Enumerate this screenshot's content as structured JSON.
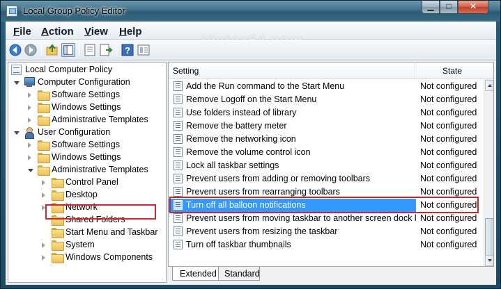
{
  "window": {
    "title": "Local Group Policy Editor",
    "min_glyph": "▁",
    "max_glyph": "□",
    "close_glyph": "✕"
  },
  "menu": {
    "file": {
      "key": "F",
      "rest": "ile"
    },
    "action": {
      "key": "A",
      "rest": "ction"
    },
    "view": {
      "key": "V",
      "rest": "iew"
    },
    "help": {
      "key": "H",
      "rest": "elp"
    }
  },
  "watermark": "Vistax64.com",
  "toolbar": {
    "icons": [
      "back-icon",
      "forward-icon",
      "up-folder-icon",
      "show-hide-tree-icon",
      "properties-icon",
      "export-list-icon",
      "help-icon",
      "filter-icon"
    ]
  },
  "tree": {
    "root": "Local Computer Policy",
    "computer_config": "Computer Configuration",
    "cc_software": "Software Settings",
    "cc_windows": "Windows Settings",
    "cc_admin": "Administrative Templates",
    "user_config": "User Configuration",
    "uc_software": "Software Settings",
    "uc_windows": "Windows Settings",
    "uc_admin": "Administrative Templates",
    "control_panel": "Control Panel",
    "desktop": "Desktop",
    "network": "Network",
    "shared_folders": "Shared Folders",
    "start_menu": "Start Menu and Taskbar",
    "system": "System",
    "windows_components": "Windows Components"
  },
  "list": {
    "col_setting": "Setting",
    "col_state": "State",
    "rows": [
      {
        "name": "Add the Run command to the Start Menu",
        "state": "Not configured"
      },
      {
        "name": "Remove Logoff on the Start Menu",
        "state": "Not configured"
      },
      {
        "name": "Use folders instead of library",
        "state": "Not configured"
      },
      {
        "name": "Remove the battery meter",
        "state": "Not configured"
      },
      {
        "name": "Remove the networking icon",
        "state": "Not configured"
      },
      {
        "name": "Remove the volume control icon",
        "state": "Not configured"
      },
      {
        "name": "Lock all taskbar settings",
        "state": "Not configured"
      },
      {
        "name": "Prevent users from adding or removing toolbars",
        "state": "Not configured"
      },
      {
        "name": "Prevent users from rearranging toolbars",
        "state": "Not configured"
      },
      {
        "name": "Turn off all balloon notifications",
        "state": "Not configured"
      },
      {
        "name": "Prevent users from moving taskbar to another screen dock l...",
        "state": "Not configured"
      },
      {
        "name": "Prevent users from resizing the taskbar",
        "state": "Not configured"
      },
      {
        "name": "Turn off taskbar thumbnails",
        "state": "Not configured"
      }
    ]
  },
  "tabs": {
    "extended": "Extended",
    "standard": "Standard"
  },
  "colors": {
    "selection": "#3399ff",
    "highlight_box": "#c8282e"
  }
}
